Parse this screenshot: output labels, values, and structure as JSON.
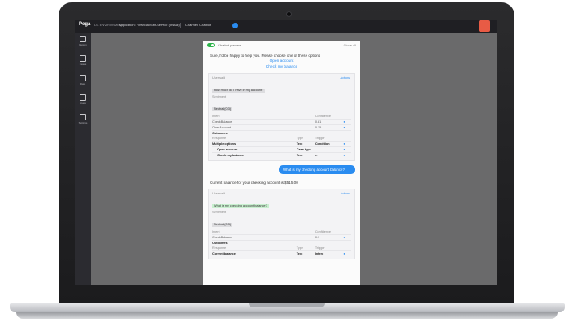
{
  "topbar": {
    "brand": "Pega",
    "env": "DX ENVIRONMENT",
    "app": "Application: Financial Self-Service (Install)",
    "channel": "Channel: Chatbot"
  },
  "sidebar": {
    "items": [
      {
        "label": "Design",
        "icon": "grid-icon"
      },
      {
        "label": "Cases",
        "icon": "briefcase-icon"
      },
      {
        "label": "Data",
        "icon": "database-icon"
      },
      {
        "label": "Users",
        "icon": "users-icon"
      },
      {
        "label": "Settings",
        "icon": "gear-icon"
      }
    ]
  },
  "chat": {
    "title": "Chatbot preview",
    "close": "Close all",
    "bot_message": "Sure, I'd be happy to help you. Please choose one of these options",
    "options": [
      "Open account",
      "Check my balance"
    ],
    "card1": {
      "user_said_label": "User said",
      "user_said": "How much do I have in my account?",
      "sentiment_label": "Sentiment",
      "sentiment": "Neutral (0.3)",
      "action": "Actions",
      "intents_header": [
        "Intent",
        "",
        "Confidence",
        ""
      ],
      "intents": [
        [
          "CheckBalance",
          "",
          "0.81",
          ""
        ],
        [
          "OpenAccount",
          "",
          "0.15",
          ""
        ]
      ],
      "outcomes_label": "Outcomes",
      "outcomes_header": [
        "Response",
        "Type",
        "Trigger",
        ""
      ],
      "outcomes": [
        [
          "Multiple options",
          "Text",
          "Condition",
          ""
        ],
        [
          "Open account",
          "Case type",
          "--",
          ""
        ],
        [
          "Check my balance",
          "Text",
          "--",
          ""
        ]
      ]
    },
    "user_message": "What is my checking account balance?",
    "bot_message2": "Current balance for your checking account is $515.00",
    "card2": {
      "user_said_label": "User said",
      "user_said": "What is my checking account balance?",
      "sentiment_label": "Sentiment",
      "sentiment": "Neutral (0.3)",
      "action": "Actions",
      "intents_header": [
        "Intent",
        "",
        "Confidence",
        ""
      ],
      "intents": [
        [
          "CheckBalance",
          "",
          "0.9",
          ""
        ]
      ],
      "outcomes_label": "Outcomes",
      "outcomes_header": [
        "Response",
        "Type",
        "Trigger",
        ""
      ],
      "outcomes": [
        [
          "Current balance",
          "Text",
          "Intent",
          ""
        ]
      ]
    }
  }
}
